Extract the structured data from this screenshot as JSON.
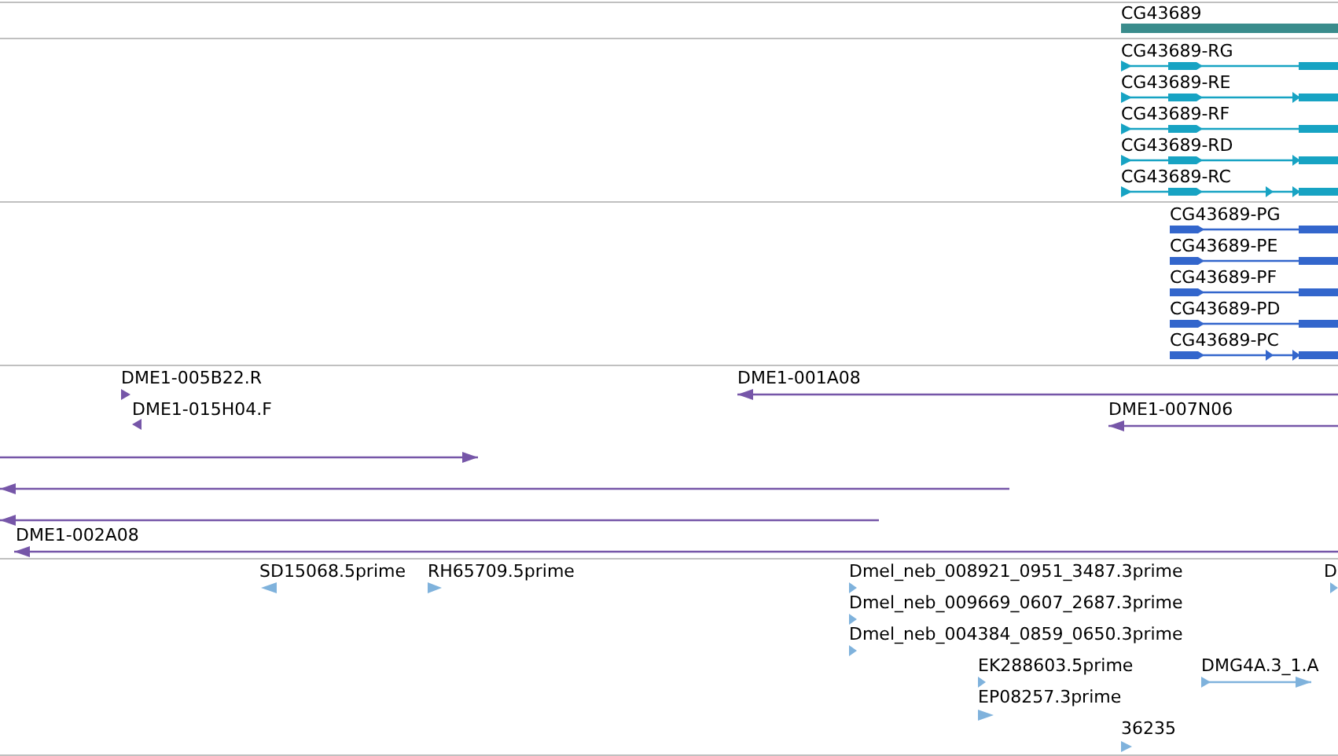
{
  "tracks": [
    {
      "kind": "gene",
      "features": [
        {
          "label": "CG43689"
        }
      ]
    },
    {
      "kind": "transcript",
      "features": [
        {
          "label": "CG43689-RG",
          "reverse": false
        },
        {
          "label": "CG43689-RE",
          "reverse": false
        },
        {
          "label": "CG43689-RF",
          "reverse": false
        },
        {
          "label": "CG43689-RD",
          "reverse": false
        },
        {
          "label": "CG43689-RC",
          "reverse": false
        }
      ]
    },
    {
      "kind": "protein",
      "features": [
        {
          "label": "CG43689-PG",
          "reverse": false
        },
        {
          "label": "CG43689-PE",
          "reverse": false
        },
        {
          "label": "CG43689-PF",
          "reverse": false
        },
        {
          "label": "CG43689-PD",
          "reverse": false
        },
        {
          "label": "CG43689-PC",
          "reverse": false
        }
      ]
    },
    {
      "kind": "clone",
      "features": [
        {
          "label": "DME1-005B22.R",
          "reverse": false
        },
        {
          "label": "DME1-015H04.F",
          "reverse": true
        },
        {
          "label": "DME1-001A08",
          "reverse": true
        },
        {
          "label": "DME1-007N06",
          "reverse": true
        },
        {
          "reverse": false
        },
        {
          "reverse": true
        },
        {
          "reverse": true
        },
        {
          "label": "DME1-002A08",
          "reverse": true
        }
      ]
    },
    {
      "kind": "est",
      "features": [
        {
          "label": "SD15068.5prime",
          "reverse": true
        },
        {
          "label": "RH65709.5prime",
          "reverse": false
        },
        {
          "label": "Dmel_neb_008921_0951_3487.3prime",
          "reverse": false
        },
        {
          "label": "Dmel_neb_009669_0607_2687.3prime",
          "reverse": false
        },
        {
          "label": "Dmel_neb_004384_0859_0650.3prime",
          "reverse": false
        },
        {
          "label": "EK288603.5prime",
          "reverse": false
        },
        {
          "label": "EP08257.3prime",
          "reverse": false
        },
        {
          "label": "36235",
          "reverse": false
        },
        {
          "label": "DMG4A.3_1.A",
          "reverse": false
        },
        {
          "label": "D",
          "reverse": false
        }
      ]
    }
  ]
}
